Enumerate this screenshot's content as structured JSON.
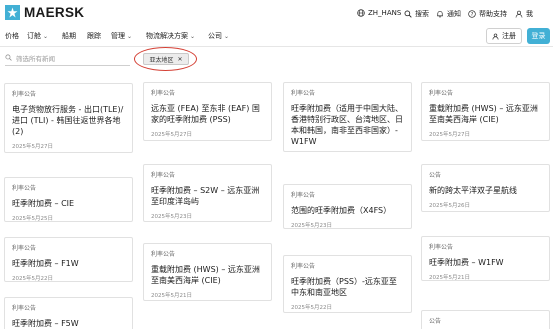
{
  "header": {
    "brand": "MAERSK",
    "language": "ZH_HANS",
    "search": "搜索",
    "notifications": "通知",
    "help": "帮助支持",
    "my_account": "我"
  },
  "nav": {
    "items": [
      {
        "label": "价格",
        "has_dropdown": false
      },
      {
        "label": "订舱",
        "has_dropdown": true
      },
      {
        "label": "船期",
        "has_dropdown": false
      },
      {
        "label": "跟踪",
        "has_dropdown": false
      },
      {
        "label": "管理",
        "has_dropdown": true
      },
      {
        "label": "物流解决方案",
        "has_dropdown": true
      },
      {
        "label": "公司",
        "has_dropdown": true
      }
    ],
    "register": "注册",
    "login": "登录"
  },
  "filter": {
    "search_placeholder": "筛选所有新闻",
    "chip_label": "亚太地区"
  },
  "cards": [
    {
      "category": "利率公告",
      "title": "电子货物放行服务 - 出口(TLE)/进口 (TLI) - 韩国往返世界各地 (2)",
      "date": "2025年5月27日"
    },
    {
      "category": "利率公告",
      "title": "旺季附加费 – CIE",
      "date": "2025年5月25日"
    },
    {
      "category": "利率公告",
      "title": "旺季附加费 – F1W",
      "date": "2025年5月22日"
    },
    {
      "category": "利率公告",
      "title": "旺季附加费 – F5W",
      "date": ""
    },
    {
      "category": "利率公告",
      "title": "远东亚 (FEA) 至东非 (EAF) 国家的旺季附加费 (PSS)",
      "date": "2025年5月27日"
    },
    {
      "category": "利率公告",
      "title": "旺季附加费 – S2W – 远东亚洲至印度洋岛屿",
      "date": "2025年5月23日"
    },
    {
      "category": "利率公告",
      "title": "重载附加费 (HWS) – 远东亚洲至南美西海岸 (CIE)",
      "date": "2025年5月21日"
    },
    {
      "category": "利率公告",
      "title": "旺季附加费（适用于中国大陆、香港特别行政区、台湾地区、日本和韩国，南非至西非国家）- W1FW",
      "date": ""
    },
    {
      "category": "利率公告",
      "title": "范围的旺季附加费（X4FS）",
      "date": "2025年5月23日"
    },
    {
      "category": "利率公告",
      "title": "旺季附加费（PSS）-远东亚至中东和南亚地区",
      "date": "2025年5月22日"
    },
    {
      "category": "利率公告",
      "title": "重载附加费 (HWS) – 远东亚洲至南美西海岸 (CIE)",
      "date": "2025年5月27日"
    },
    {
      "category": "公告",
      "title": "新的跨太平洋双子星航线",
      "date": "2025年5月26日"
    },
    {
      "category": "利率公告",
      "title": "旺季附加费 – W1FW",
      "date": "2025年5月21日"
    },
    {
      "category": "公告",
      "title": "",
      "date": ""
    }
  ]
}
